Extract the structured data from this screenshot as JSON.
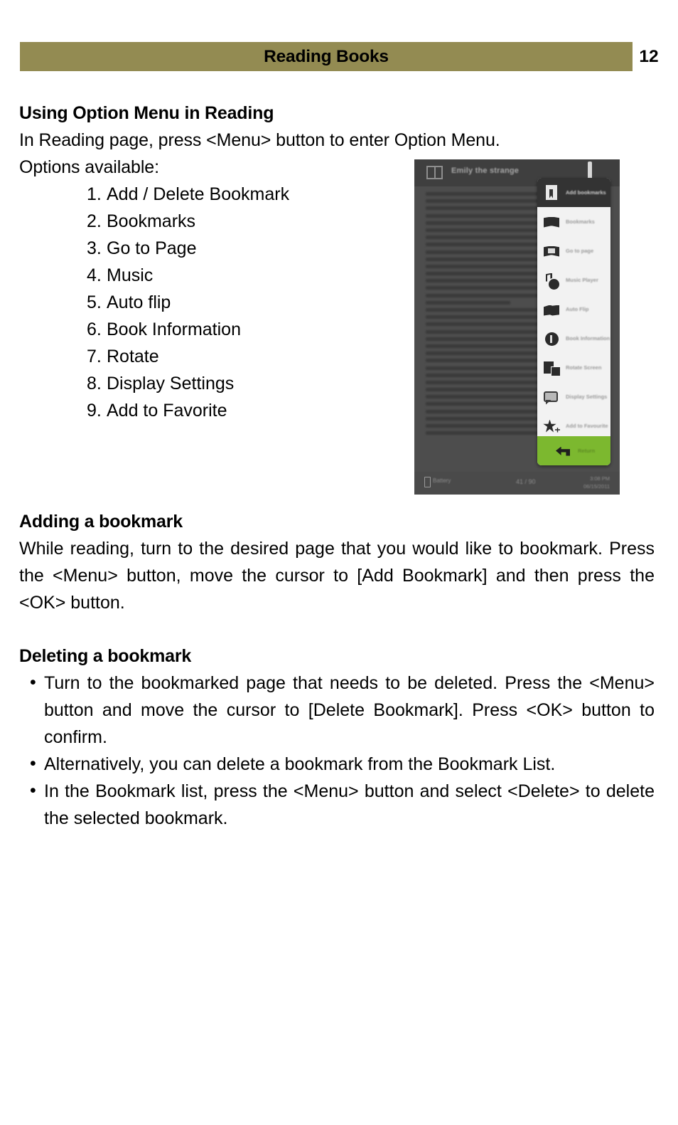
{
  "header": {
    "title": "Reading Books",
    "page_number": "12",
    "bar_color": "#938b52"
  },
  "sections": {
    "option_menu": {
      "heading": "Using Option Menu in Reading",
      "intro_line": "In Reading page, press <Menu> button to enter Option Menu.",
      "options_label": "Options available:",
      "options": [
        {
          "num": "1.",
          "label": "Add / Delete Bookmark"
        },
        {
          "num": "2.",
          "label": "Bookmarks"
        },
        {
          "num": "3.",
          "label": "Go to Page"
        },
        {
          "num": "4.",
          "label": "Music"
        },
        {
          "num": "5.",
          "label": "Auto flip"
        },
        {
          "num": "6.",
          "label": "Book Information"
        },
        {
          "num": "7.",
          "label": "Rotate"
        },
        {
          "num": "8.",
          "label": "Display Settings"
        },
        {
          "num": "9.",
          "label": "Add to Favorite"
        }
      ]
    },
    "adding_bookmark": {
      "heading": "Adding a bookmark",
      "body": "While reading, turn to the desired page that you would like to bookmark. Press the <Menu> button, move the cursor to [Add Bookmark] and then press the <OK> button."
    },
    "deleting_bookmark": {
      "heading": "Deleting a bookmark",
      "bullets": [
        "Turn to the bookmarked page that needs to be deleted. Press the <Menu> button and move the cursor to [Delete Bookmark]. Press <OK>  button to confirm.",
        "Alternatively, you can delete a bookmark from the Bookmark List.",
        "In the Bookmark list, press the <Menu> button and select <Delete> to delete the selected bookmark."
      ]
    }
  },
  "device_screenshot": {
    "book_title": "Emily the strange",
    "status_bar": {
      "battery": "Battery",
      "page_info": "41 / 90",
      "time": "3:08 PM",
      "date": "06/15/2011"
    },
    "menu": {
      "selected_index": 0,
      "return_label": "Return",
      "return_color": "#7cb82f",
      "items": [
        {
          "label": "Add bookmarks",
          "icon": "add-bookmark-icon"
        },
        {
          "label": "Bookmarks",
          "icon": "bookmarks-icon"
        },
        {
          "label": "Go to page",
          "icon": "goto-page-icon"
        },
        {
          "label": "Music Player",
          "icon": "music-player-icon"
        },
        {
          "label": "Auto Flip",
          "icon": "auto-flip-icon"
        },
        {
          "label": "Book Information",
          "icon": "book-information-icon"
        },
        {
          "label": "Rotate Screen",
          "icon": "rotate-screen-icon"
        },
        {
          "label": "Display Settings",
          "icon": "display-settings-icon"
        },
        {
          "label": "Add to Favourite",
          "icon": "add-favourite-icon"
        }
      ]
    }
  }
}
